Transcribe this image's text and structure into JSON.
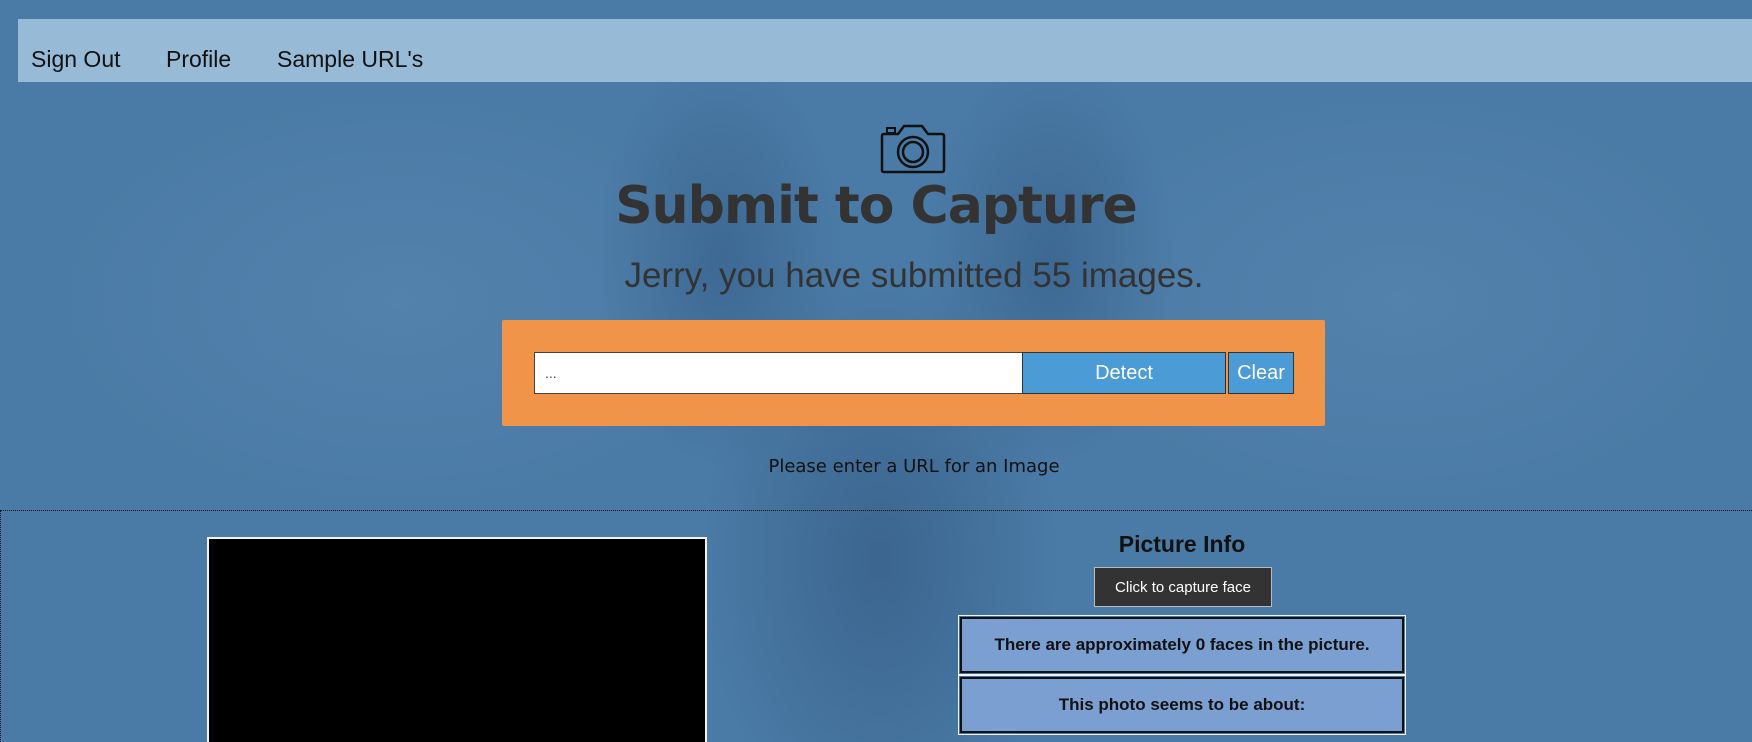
{
  "nav": {
    "items": [
      {
        "label": "Sign Out"
      },
      {
        "label": "Profile"
      },
      {
        "label": "Sample URL's"
      }
    ]
  },
  "header": {
    "icon": "camera-icon",
    "title": "Submit to Capture",
    "subtitle": "Jerry, you have submitted 55 images."
  },
  "form": {
    "url_placeholder": "...",
    "url_value": "",
    "detect_label": "Detect",
    "clear_label": "Clear",
    "hint": "Please enter a URL for an Image"
  },
  "info": {
    "title": "Picture Info",
    "capture_label": "Click to capture face",
    "faces_text": "There are approximately 0 faces in the picture.",
    "about_text": "This photo seems to be about:"
  },
  "colors": {
    "background": "#4a7ba6",
    "nav_bar": "#97bad6",
    "form_box": "#f0944a",
    "button_blue": "#4a9bd6",
    "info_box": "#7b9fd1"
  }
}
